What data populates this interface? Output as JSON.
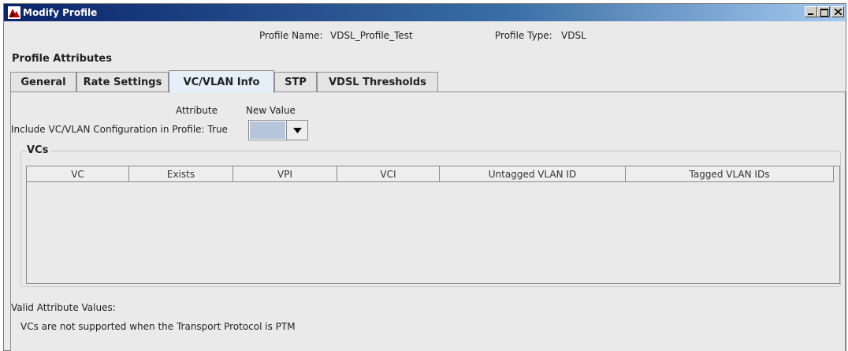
{
  "window": {
    "title": "Modify Profile",
    "icon": "app-logo-icon",
    "controls": [
      "minimize-icon",
      "maximize-icon",
      "close-icon"
    ]
  },
  "header": {
    "profile_name_label": "Profile Name:",
    "profile_name": "VDSL_Profile_Test",
    "profile_type_label": "Profile Type:",
    "profile_type": "VDSL"
  },
  "group_title": "Profile Attributes",
  "tabs": [
    {
      "label": "General",
      "active": false
    },
    {
      "label": "Rate Settings",
      "active": false
    },
    {
      "label": "VC/VLAN Info",
      "active": true
    },
    {
      "label": "STP",
      "active": false
    },
    {
      "label": "VDSL Thresholds",
      "active": false
    }
  ],
  "panel": {
    "attribute_header": "Attribute",
    "new_value_header": "New Value",
    "include_label": "Include VC/VLAN Configuration in Profile:",
    "include_current": "True",
    "include_new_value": ""
  },
  "vcs": {
    "title": "VCs",
    "columns": [
      "VC",
      "Exists",
      "VPI",
      "VCI",
      "Untagged VLAN ID",
      "Tagged VLAN IDs"
    ],
    "rows": []
  },
  "valid": {
    "label": "Valid Attribute Values:",
    "message": "VCs are not supported when the Transport Protocol is PTM"
  },
  "colors": {
    "titlebar_start": "#0a246a",
    "titlebar_end": "#a6caf0",
    "window_bg": "#eaeaea",
    "active_tab_bg": "#e6eef8",
    "combo_value_bg": "#b6c6da"
  }
}
